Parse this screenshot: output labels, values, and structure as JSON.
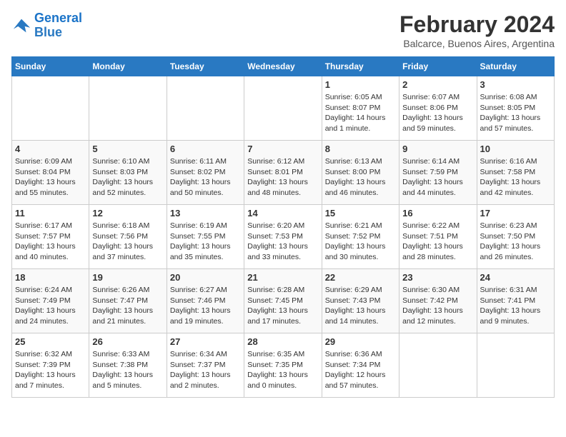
{
  "header": {
    "logo_line1": "General",
    "logo_line2": "Blue",
    "month_year": "February 2024",
    "location": "Balcarce, Buenos Aires, Argentina"
  },
  "weekdays": [
    "Sunday",
    "Monday",
    "Tuesday",
    "Wednesday",
    "Thursday",
    "Friday",
    "Saturday"
  ],
  "weeks": [
    [
      {
        "day": "",
        "info": ""
      },
      {
        "day": "",
        "info": ""
      },
      {
        "day": "",
        "info": ""
      },
      {
        "day": "",
        "info": ""
      },
      {
        "day": "1",
        "info": "Sunrise: 6:05 AM\nSunset: 8:07 PM\nDaylight: 14 hours\nand 1 minute."
      },
      {
        "day": "2",
        "info": "Sunrise: 6:07 AM\nSunset: 8:06 PM\nDaylight: 13 hours\nand 59 minutes."
      },
      {
        "day": "3",
        "info": "Sunrise: 6:08 AM\nSunset: 8:05 PM\nDaylight: 13 hours\nand 57 minutes."
      }
    ],
    [
      {
        "day": "4",
        "info": "Sunrise: 6:09 AM\nSunset: 8:04 PM\nDaylight: 13 hours\nand 55 minutes."
      },
      {
        "day": "5",
        "info": "Sunrise: 6:10 AM\nSunset: 8:03 PM\nDaylight: 13 hours\nand 52 minutes."
      },
      {
        "day": "6",
        "info": "Sunrise: 6:11 AM\nSunset: 8:02 PM\nDaylight: 13 hours\nand 50 minutes."
      },
      {
        "day": "7",
        "info": "Sunrise: 6:12 AM\nSunset: 8:01 PM\nDaylight: 13 hours\nand 48 minutes."
      },
      {
        "day": "8",
        "info": "Sunrise: 6:13 AM\nSunset: 8:00 PM\nDaylight: 13 hours\nand 46 minutes."
      },
      {
        "day": "9",
        "info": "Sunrise: 6:14 AM\nSunset: 7:59 PM\nDaylight: 13 hours\nand 44 minutes."
      },
      {
        "day": "10",
        "info": "Sunrise: 6:16 AM\nSunset: 7:58 PM\nDaylight: 13 hours\nand 42 minutes."
      }
    ],
    [
      {
        "day": "11",
        "info": "Sunrise: 6:17 AM\nSunset: 7:57 PM\nDaylight: 13 hours\nand 40 minutes."
      },
      {
        "day": "12",
        "info": "Sunrise: 6:18 AM\nSunset: 7:56 PM\nDaylight: 13 hours\nand 37 minutes."
      },
      {
        "day": "13",
        "info": "Sunrise: 6:19 AM\nSunset: 7:55 PM\nDaylight: 13 hours\nand 35 minutes."
      },
      {
        "day": "14",
        "info": "Sunrise: 6:20 AM\nSunset: 7:53 PM\nDaylight: 13 hours\nand 33 minutes."
      },
      {
        "day": "15",
        "info": "Sunrise: 6:21 AM\nSunset: 7:52 PM\nDaylight: 13 hours\nand 30 minutes."
      },
      {
        "day": "16",
        "info": "Sunrise: 6:22 AM\nSunset: 7:51 PM\nDaylight: 13 hours\nand 28 minutes."
      },
      {
        "day": "17",
        "info": "Sunrise: 6:23 AM\nSunset: 7:50 PM\nDaylight: 13 hours\nand 26 minutes."
      }
    ],
    [
      {
        "day": "18",
        "info": "Sunrise: 6:24 AM\nSunset: 7:49 PM\nDaylight: 13 hours\nand 24 minutes."
      },
      {
        "day": "19",
        "info": "Sunrise: 6:26 AM\nSunset: 7:47 PM\nDaylight: 13 hours\nand 21 minutes."
      },
      {
        "day": "20",
        "info": "Sunrise: 6:27 AM\nSunset: 7:46 PM\nDaylight: 13 hours\nand 19 minutes."
      },
      {
        "day": "21",
        "info": "Sunrise: 6:28 AM\nSunset: 7:45 PM\nDaylight: 13 hours\nand 17 minutes."
      },
      {
        "day": "22",
        "info": "Sunrise: 6:29 AM\nSunset: 7:43 PM\nDaylight: 13 hours\nand 14 minutes."
      },
      {
        "day": "23",
        "info": "Sunrise: 6:30 AM\nSunset: 7:42 PM\nDaylight: 13 hours\nand 12 minutes."
      },
      {
        "day": "24",
        "info": "Sunrise: 6:31 AM\nSunset: 7:41 PM\nDaylight: 13 hours\nand 9 minutes."
      }
    ],
    [
      {
        "day": "25",
        "info": "Sunrise: 6:32 AM\nSunset: 7:39 PM\nDaylight: 13 hours\nand 7 minutes."
      },
      {
        "day": "26",
        "info": "Sunrise: 6:33 AM\nSunset: 7:38 PM\nDaylight: 13 hours\nand 5 minutes."
      },
      {
        "day": "27",
        "info": "Sunrise: 6:34 AM\nSunset: 7:37 PM\nDaylight: 13 hours\nand 2 minutes."
      },
      {
        "day": "28",
        "info": "Sunrise: 6:35 AM\nSunset: 7:35 PM\nDaylight: 13 hours\nand 0 minutes."
      },
      {
        "day": "29",
        "info": "Sunrise: 6:36 AM\nSunset: 7:34 PM\nDaylight: 12 hours\nand 57 minutes."
      },
      {
        "day": "",
        "info": ""
      },
      {
        "day": "",
        "info": ""
      }
    ]
  ]
}
